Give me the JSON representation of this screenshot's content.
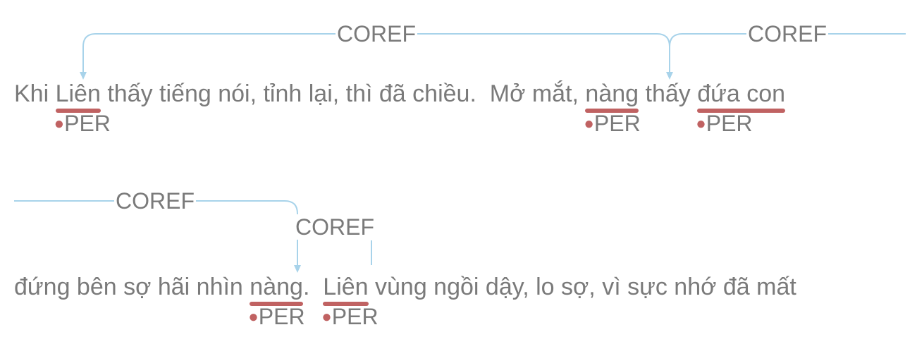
{
  "colors": {
    "arc": "#a8d3ea",
    "mention": "#c06262",
    "text": "#7a7a7a"
  },
  "line1": {
    "t0": "Khi ",
    "m1": "Liên",
    "t1": " thấy tiếng nói, tỉnh lại, thì đã chiều.  Mở mắt, ",
    "m2": "nàng",
    "t2": " thấy ",
    "m3": "đứa con"
  },
  "line2": {
    "t0": "đứng bên sợ hãi nhìn ",
    "m4": "nàng",
    "t1": ".  ",
    "m5": "Liên",
    "t2": " vùng ngồi dậy, lo sợ, vì sực nhớ đã mất"
  },
  "entity_label": "PER",
  "relation_label": "COREF",
  "relations": [
    {
      "label": "COREF",
      "from": "Liên",
      "to": "nàng"
    },
    {
      "label": "COREF",
      "from": "đứa con",
      "to": "nàng"
    },
    {
      "label": "COREF",
      "from": "đứa con",
      "to": "nàng"
    },
    {
      "label": "COREF",
      "from": "Liên",
      "to": "nàng"
    }
  ]
}
